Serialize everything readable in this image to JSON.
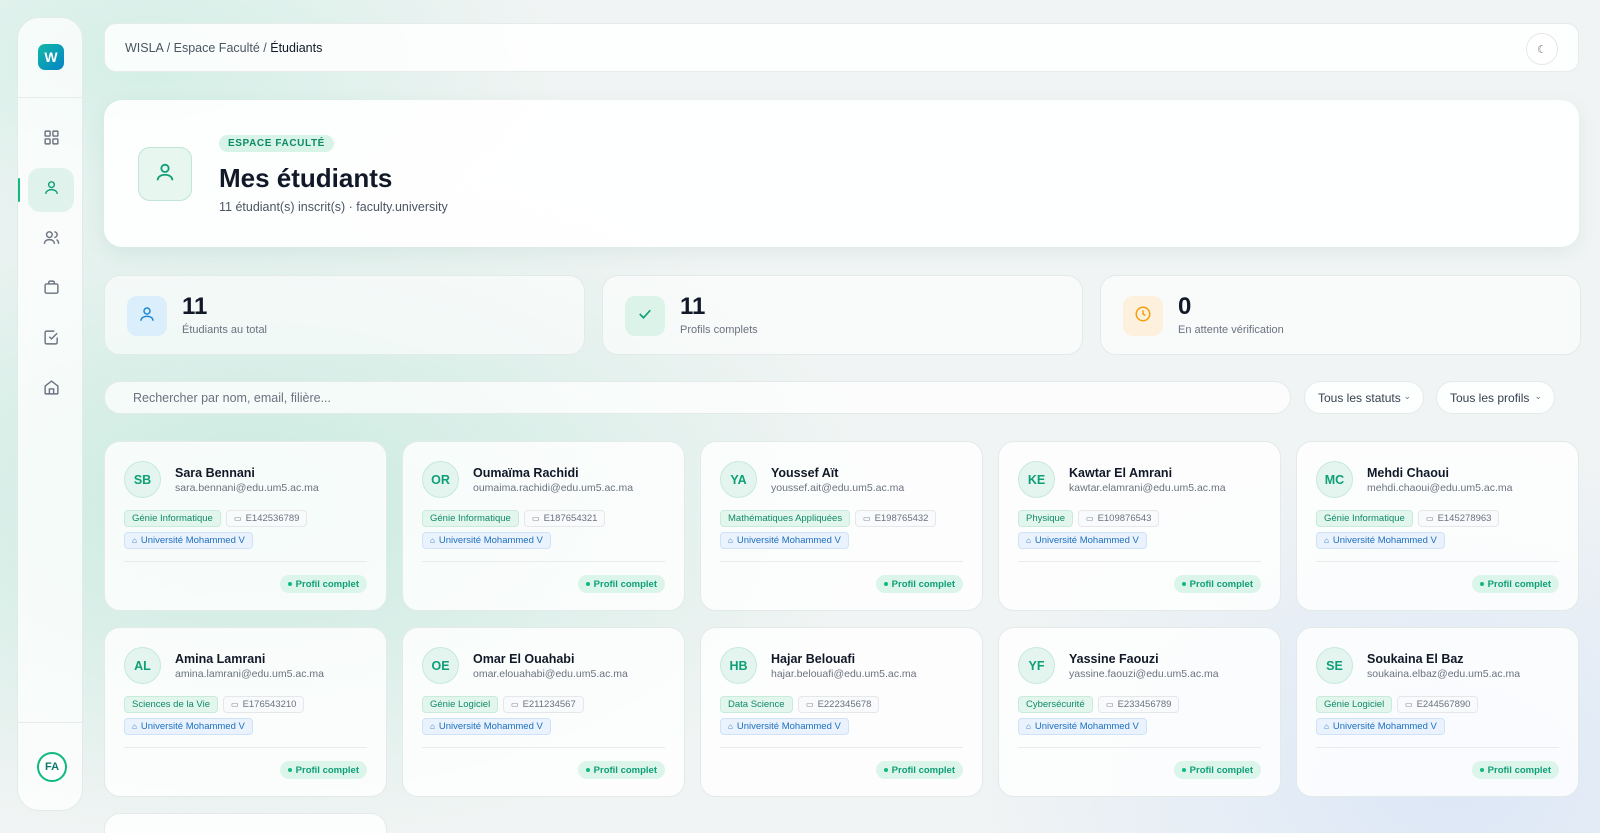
{
  "app": {
    "logo_letter": "W",
    "user_initials": "FA"
  },
  "sidebar": {
    "items": [
      {
        "name": "dashboard",
        "icon": "grid-icon"
      },
      {
        "name": "students",
        "icon": "user-icon",
        "active": true
      },
      {
        "name": "users",
        "icon": "users-icon"
      },
      {
        "name": "offers",
        "icon": "briefcase-icon"
      },
      {
        "name": "tasks",
        "icon": "check-square-icon"
      },
      {
        "name": "institution",
        "icon": "building-icon"
      }
    ]
  },
  "topbar": {
    "breadcrumb": {
      "root": "WISLA",
      "section": "Espace Faculté",
      "current": "Étudiants",
      "separator": " / "
    },
    "theme_icon": "☾"
  },
  "hero": {
    "badge": "ESPACE FACULTÉ",
    "title": "Mes étudiants",
    "subtitle": "11 étudiant(s) inscrit(s) · faculty.university"
  },
  "stats": [
    {
      "value": "11",
      "label": "Étudiants au total",
      "icon": "user-icon",
      "bg": "#dbeefb",
      "fg": "#1e88d4"
    },
    {
      "value": "11",
      "label": "Profils complets",
      "icon": "check-icon",
      "bg": "#dcf3ea",
      "fg": "#0f9f77"
    },
    {
      "value": "0",
      "label": "En attente vérification",
      "icon": "clock-icon",
      "bg": "#fdf0dc",
      "fg": "#f59e0b"
    }
  ],
  "filters": {
    "search_placeholder": "Rechercher par nom, email, filière...",
    "status_select": "Tous les statuts",
    "profile_select": "Tous les profils"
  },
  "students": [
    {
      "initials": "SB",
      "name": "Sara Bennani",
      "email": "sara.bennani@edu.um5.ac.ma",
      "filiere": "Génie Informatique",
      "matricule": "E142536789",
      "universite": "Université Mohammed V",
      "status": "Profil complet"
    },
    {
      "initials": "OR",
      "name": "Oumaïma Rachidi",
      "email": "oumaima.rachidi@edu.um5.ac.ma",
      "filiere": "Génie Informatique",
      "matricule": "E187654321",
      "universite": "Université Mohammed V",
      "status": "Profil complet"
    },
    {
      "initials": "YA",
      "name": "Youssef Aït",
      "email": "youssef.ait@edu.um5.ac.ma",
      "filiere": "Mathématiques Appliquées",
      "matricule": "E198765432",
      "universite": "Université Mohammed V",
      "status": "Profil complet"
    },
    {
      "initials": "KE",
      "name": "Kawtar El Amrani",
      "email": "kawtar.elamrani@edu.um5.ac.ma",
      "filiere": "Physique",
      "matricule": "E109876543",
      "universite": "Université Mohammed V",
      "status": "Profil complet"
    },
    {
      "initials": "MC",
      "name": "Mehdi Chaoui",
      "email": "mehdi.chaoui@edu.um5.ac.ma",
      "filiere": "Génie Informatique",
      "matricule": "E145278963",
      "universite": "Université Mohammed V",
      "status": "Profil complet"
    },
    {
      "initials": "AL",
      "name": "Amina Lamrani",
      "email": "amina.lamrani@edu.um5.ac.ma",
      "filiere": "Sciences de la Vie",
      "matricule": "E176543210",
      "universite": "Université Mohammed V",
      "status": "Profil complet"
    },
    {
      "initials": "OE",
      "name": "Omar El Ouahabi",
      "email": "omar.elouahabi@edu.um5.ac.ma",
      "filiere": "Génie Logiciel",
      "matricule": "E211234567",
      "universite": "Université Mohammed V",
      "status": "Profil complet"
    },
    {
      "initials": "HB",
      "name": "Hajar Belouafi",
      "email": "hajar.belouafi@edu.um5.ac.ma",
      "filiere": "Data Science",
      "matricule": "E222345678",
      "universite": "Université Mohammed V",
      "status": "Profil complet"
    },
    {
      "initials": "YF",
      "name": "Yassine Faouzi",
      "email": "yassine.faouzi@edu.um5.ac.ma",
      "filiere": "Cybersécurité",
      "matricule": "E233456789",
      "universite": "Université Mohammed V",
      "status": "Profil complet"
    },
    {
      "initials": "SE",
      "name": "Soukaina El Baz",
      "email": "soukaina.elbaz@edu.um5.ac.ma",
      "filiere": "Génie Logiciel",
      "matricule": "E244567890",
      "universite": "Université Mohammed V",
      "status": "Profil complet"
    }
  ]
}
